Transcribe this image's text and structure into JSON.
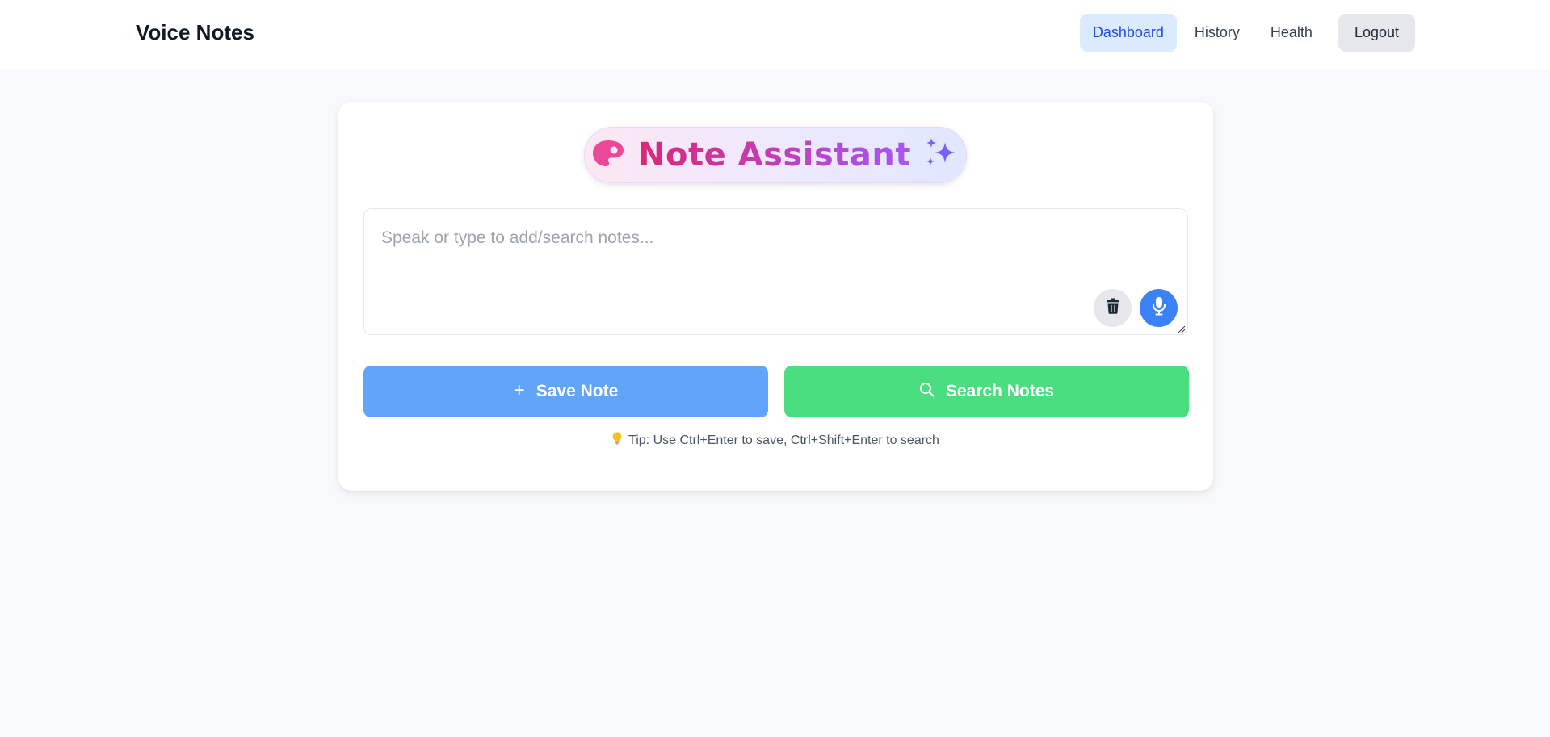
{
  "app": {
    "title": "Voice Notes"
  },
  "nav": {
    "items": [
      {
        "label": "Dashboard",
        "active": true
      },
      {
        "label": "History",
        "active": false
      },
      {
        "label": "Health",
        "active": false
      }
    ],
    "logout_label": "Logout"
  },
  "assistant": {
    "title": "Note Assistant",
    "left_icon": "palette-icon",
    "right_icon": "sparkles-icon"
  },
  "input": {
    "placeholder": "Speak or type to add/search notes...",
    "value": ""
  },
  "actions": {
    "save_label": "Save Note",
    "search_label": "Search Notes"
  },
  "tip": {
    "icon": "lightbulb-icon",
    "text": "Tip: Use Ctrl+Enter to save, Ctrl+Shift+Enter to search"
  },
  "colors": {
    "primary": "#3b82f6",
    "save": "#60a5fa",
    "search": "#4ade80",
    "pink": "#ec4899",
    "violet": "#a855f7"
  }
}
